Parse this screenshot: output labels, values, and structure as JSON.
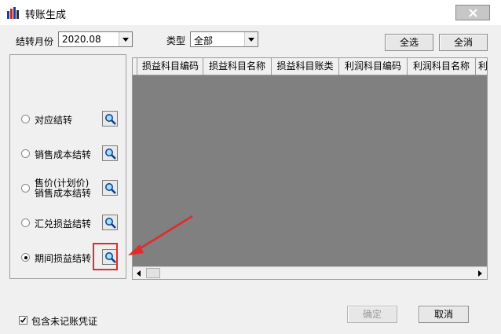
{
  "window": {
    "title": "转账生成",
    "close_icon": "close-icon"
  },
  "toolbar": {
    "month_label": "结转月份",
    "month_value": "2020.08",
    "type_label": "类型",
    "type_value": "全部",
    "select_all": "全选",
    "clear_all": "全消"
  },
  "options": [
    {
      "label": "对应结转",
      "checked": false
    },
    {
      "label": "销售成本结转",
      "checked": false
    },
    {
      "label_line1": "售价(计划价)",
      "label_line2": "销售成本结转",
      "checked": false
    },
    {
      "label": "汇兑损益结转",
      "checked": false
    },
    {
      "label": "期间损益结转",
      "checked": true
    }
  ],
  "grid": {
    "columns": [
      "损益科目编码",
      "损益科目名称",
      "损益科目账类",
      "利润科目编码",
      "利润科目名称",
      "利"
    ]
  },
  "footer": {
    "include_unposted": "包含未记账凭证",
    "include_unposted_checked": true,
    "ok": "确定",
    "cancel": "取消"
  },
  "annotation": {
    "color": "#e32a2a"
  }
}
